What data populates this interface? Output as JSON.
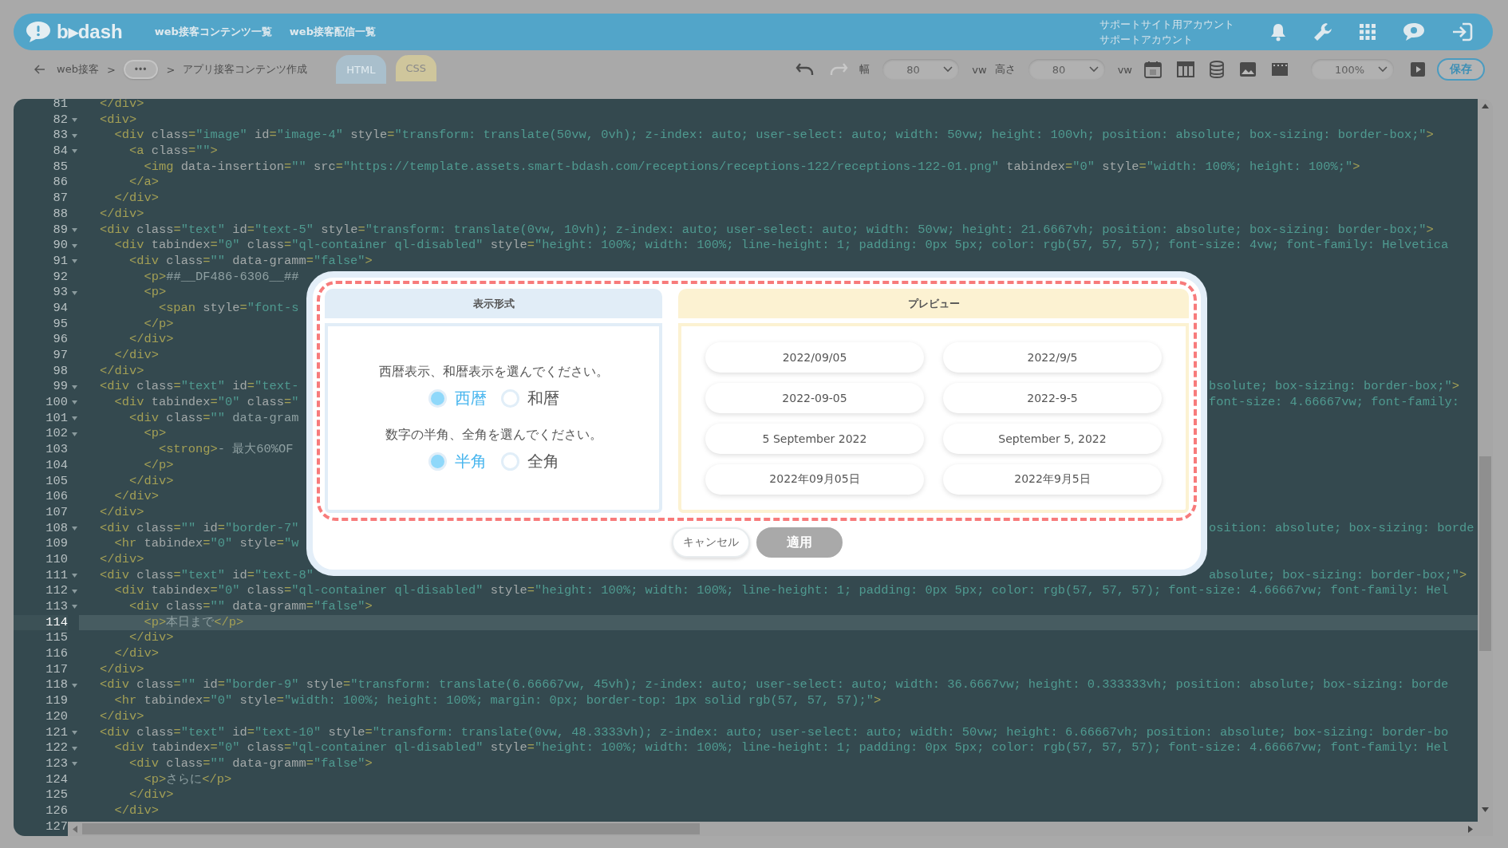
{
  "header": {
    "logo": "b▸dash",
    "nav_links": [
      "web接客コンテンツ一覧",
      "web接客配信一覧"
    ],
    "account_lines": [
      "サポートサイト用アカウント",
      "サポートアカウント"
    ]
  },
  "toolbar": {
    "breadcrumb": [
      {
        "kind": "link",
        "label": "web接客"
      },
      {
        "kind": "sep",
        "label": ">"
      },
      {
        "kind": "more",
        "label": "•••"
      },
      {
        "kind": "sep",
        "label": ">"
      },
      {
        "kind": "current",
        "label": "アプリ接客コンテンツ作成"
      }
    ],
    "tabs": [
      {
        "label": "HTML",
        "selected": true,
        "color": "#a9bfcc"
      },
      {
        "label": "CSS",
        "selected": false,
        "color": "#cfc69c"
      }
    ],
    "width_label": "幅",
    "width_value": "80",
    "width_unit": "vw",
    "height_label": "高さ",
    "height_value": "80",
    "height_unit": "vw",
    "zoom_value": "100%",
    "save": "保存"
  },
  "editor": {
    "lines": [
      {
        "number": "81",
        "text": "</div>",
        "fold": false,
        "current": false
      },
      {
        "number": "82",
        "text": "<div>",
        "fold": true,
        "current": false
      },
      {
        "number": "83",
        "text": "  <div class=\"image\" id=\"image-4\" style=\"transform: translate(50vw, 0vh); z-index: auto; user-select: auto; width: 50vw; height: 100vh; position: absolute; box-sizing: border-box;\">",
        "fold": true,
        "current": false
      },
      {
        "number": "84",
        "text": "    <a class=\"\">",
        "fold": true,
        "current": false
      },
      {
        "number": "85",
        "text": "      <img data-insertion=\"\" src=\"https://template.assets.smart-bdash.com/receptions/receptions-122/receptions-122-01.png\" tabindex=\"0\" style=\"width: 100%; height: 100%;\">",
        "fold": false,
        "current": false
      },
      {
        "number": "86",
        "text": "    </a>",
        "fold": false,
        "current": false
      },
      {
        "number": "87",
        "text": "  </div>",
        "fold": false,
        "current": false
      },
      {
        "number": "88",
        "text": "</div>",
        "fold": false,
        "current": false
      },
      {
        "number": "89",
        "text": "<div class=\"text\" id=\"text-5\" style=\"transform: translate(0vw, 10vh); z-index: auto; user-select: auto; width: 50vw; height: 21.6667vh; position: absolute; box-sizing: border-box;\">",
        "fold": true,
        "current": false
      },
      {
        "number": "90",
        "text": "  <div tabindex=\"0\" class=\"ql-container ql-disabled\" style=\"height: 100%; width: 100%; line-height: 1; padding: 0px 5px; color: rgb(57, 57, 57); font-size: 4vw; font-family: Helvetica",
        "fold": true,
        "current": false
      },
      {
        "number": "91",
        "text": "    <div class=\"\" data-gramm=\"false\">",
        "fold": true,
        "current": false
      },
      {
        "number": "92",
        "text": "      <p>##__DF486-6306__##",
        "fold": false,
        "current": false
      },
      {
        "number": "93",
        "text": "      <p>",
        "fold": true,
        "current": false
      },
      {
        "number": "94",
        "text": "        <span style=\"font-s",
        "fold": false,
        "current": false
      },
      {
        "number": "95",
        "text": "      </p>",
        "fold": false,
        "current": false
      },
      {
        "number": "96",
        "text": "    </div>",
        "fold": false,
        "current": false
      },
      {
        "number": "97",
        "text": "  </div>",
        "fold": false,
        "current": false
      },
      {
        "number": "98",
        "text": "</div>",
        "fold": false,
        "current": false
      },
      {
        "number": "99",
        "text": "<div class=\"text\" id=\"text-",
        "right": "bsolute; box-sizing: border-box;\">",
        "fold": true,
        "current": false
      },
      {
        "number": "100",
        "text": "  <div tabindex=\"0\" class=\"",
        "right": "font-size: 4.66667vw; font-family:",
        "fold": true,
        "current": false
      },
      {
        "number": "101",
        "text": "    <div class=\"\" data-gram",
        "fold": true,
        "current": false
      },
      {
        "number": "102",
        "text": "      <p>",
        "fold": true,
        "current": false
      },
      {
        "number": "103",
        "text": "        <strong>- 最大60%OF",
        "fold": false,
        "current": false
      },
      {
        "number": "104",
        "text": "      </p>",
        "fold": false,
        "current": false
      },
      {
        "number": "105",
        "text": "    </div>",
        "fold": false,
        "current": false
      },
      {
        "number": "106",
        "text": "  </div>",
        "fold": false,
        "current": false
      },
      {
        "number": "107",
        "text": "</div>",
        "fold": false,
        "current": false
      },
      {
        "number": "108",
        "text": "<div class=\"\" id=\"border-7\"",
        "right": "osition: absolute; box-sizing: borde",
        "fold": true,
        "current": false
      },
      {
        "number": "109",
        "text": "  <hr tabindex=\"0\" style=\"w",
        "fold": false,
        "current": false
      },
      {
        "number": "110",
        "text": "</div>",
        "fold": false,
        "current": false
      },
      {
        "number": "111",
        "text": "<div class=\"text\" id=\"text-8\"",
        "right": "absolute; box-sizing: border-box;\">",
        "fold": true,
        "current": false
      },
      {
        "number": "112",
        "text": "  <div tabindex=\"0\" class=\"ql-container ql-disabled\" style=\"height: 100%; width: 100%; line-height: 1; padding: 0px 5px; color: rgb(57, 57, 57); font-size: 4.66667vw; font-family: Hel",
        "fold": true,
        "current": false
      },
      {
        "number": "113",
        "text": "    <div class=\"\" data-gramm=\"false\">",
        "fold": true,
        "current": false
      },
      {
        "number": "114",
        "text": "      <p>本日まで</p>",
        "fold": false,
        "current": true
      },
      {
        "number": "115",
        "text": "    </div>",
        "fold": false,
        "current": false
      },
      {
        "number": "116",
        "text": "  </div>",
        "fold": false,
        "current": false
      },
      {
        "number": "117",
        "text": "</div>",
        "fold": false,
        "current": false
      },
      {
        "number": "118",
        "text": "<div class=\"\" id=\"border-9\" style=\"transform: translate(6.66667vw, 45vh); z-index: auto; user-select: auto; width: 36.6667vw; height: 0.333333vh; position: absolute; box-sizing: borde",
        "fold": true,
        "current": false
      },
      {
        "number": "119",
        "text": "  <hr tabindex=\"0\" style=\"width: 100%; height: 100%; margin: 0px; border-top: 1px solid rgb(57, 57, 57);\">",
        "fold": false,
        "current": false
      },
      {
        "number": "120",
        "text": "</div>",
        "fold": false,
        "current": false
      },
      {
        "number": "121",
        "text": "<div class=\"text\" id=\"text-10\" style=\"transform: translate(0vw, 48.3333vh); z-index: auto; user-select: auto; width: 50vw; height: 6.66667vh; position: absolute; box-sizing: border-bo",
        "fold": true,
        "current": false
      },
      {
        "number": "122",
        "text": "  <div tabindex=\"0\" class=\"ql-container ql-disabled\" style=\"height: 100%; width: 100%; line-height: 1; padding: 0px 5px; color: rgb(57, 57, 57); font-size: 4.66667vw; font-family: Hel",
        "fold": true,
        "current": false
      },
      {
        "number": "123",
        "text": "    <div class=\"\" data-gramm=\"false\">",
        "fold": true,
        "current": false
      },
      {
        "number": "124",
        "text": "      <p>さらに</p>",
        "fold": false,
        "current": false
      },
      {
        "number": "125",
        "text": "    </div>",
        "fold": false,
        "current": false
      },
      {
        "number": "126",
        "text": "  </div>",
        "fold": false,
        "current": false
      },
      {
        "number": "127",
        "fold": false,
        "current": false
      }
    ]
  },
  "modal": {
    "format_header": "表示形式",
    "preview_header": "プレビュー",
    "groups": [
      {
        "question": "西暦表示、和暦表示を選んでください。",
        "options": [
          {
            "label": "西暦",
            "selected": true
          },
          {
            "label": "和暦",
            "selected": false
          }
        ]
      },
      {
        "question": "数字の半角、全角を選んでください。",
        "options": [
          {
            "label": "半角",
            "selected": true
          },
          {
            "label": "全角",
            "selected": false
          }
        ]
      }
    ],
    "preview": [
      "2022/09/05",
      "2022/9/5",
      "2022-09-05",
      "2022-9-5",
      "5 September 2022",
      "September 5, 2022",
      "2022年09月05日",
      "2022年9月5日"
    ],
    "buttons": [
      {
        "label": "キャンセル",
        "disabled": false
      },
      {
        "label": "適用",
        "disabled": true
      }
    ]
  }
}
